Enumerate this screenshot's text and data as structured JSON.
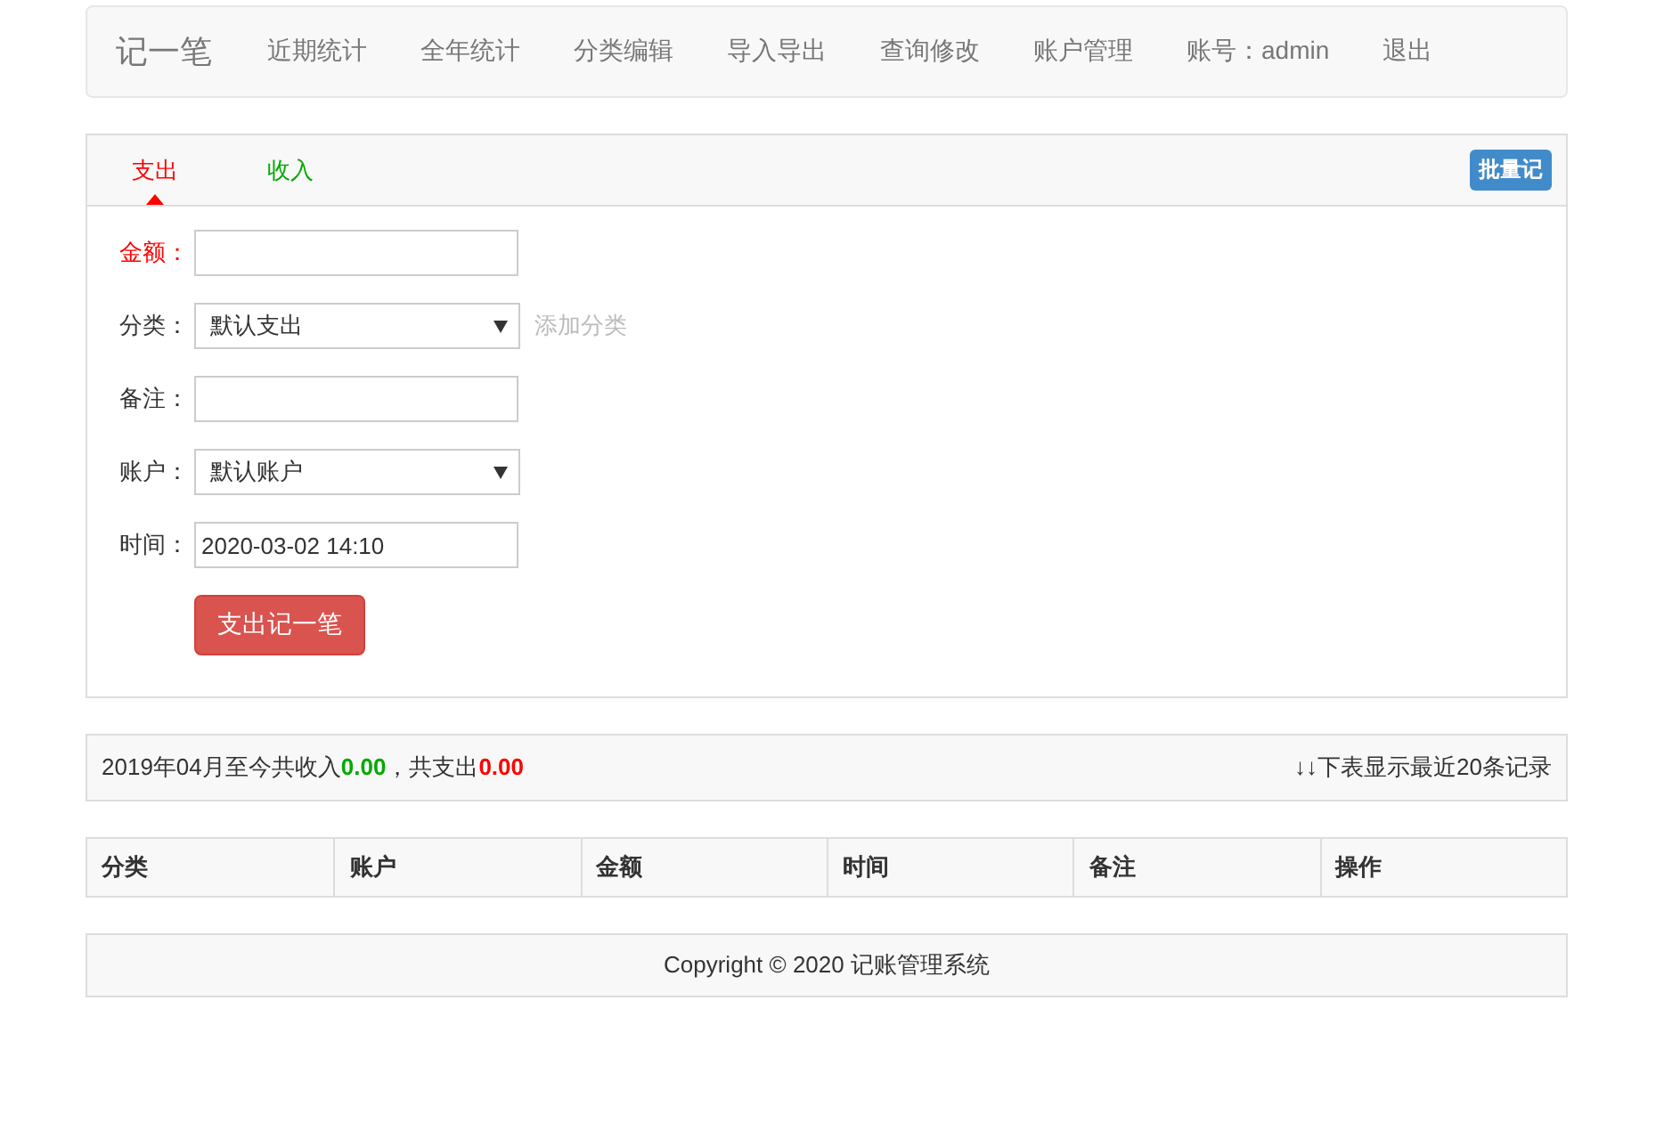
{
  "navbar": {
    "brand": "记一笔",
    "links": [
      "近期统计",
      "全年统计",
      "分类编辑",
      "导入导出",
      "查询修改",
      "账户管理",
      "账号：admin",
      "退出"
    ]
  },
  "tabs": [
    {
      "label": "支出",
      "selected": true,
      "color": "#ff0000"
    },
    {
      "label": "收入",
      "selected": false,
      "color": "#00aa00"
    }
  ],
  "batch_button": "批量记",
  "form": {
    "fields": [
      {
        "kind": "input",
        "label": "金额：",
        "required": true
      },
      {
        "kind": "select",
        "label": "分类：",
        "required": false,
        "value": "默认支出",
        "link": "添加分类"
      },
      {
        "kind": "input",
        "label": "备注：",
        "required": false
      },
      {
        "kind": "select",
        "label": "账户：",
        "required": false,
        "value": "默认账户"
      },
      {
        "kind": "input",
        "label": "时间：",
        "required": false,
        "value": "2020-03-02 14:10"
      }
    ],
    "submit": "支出记一笔"
  },
  "summary": {
    "before": "2019年04月至今共收入",
    "income": "0.00",
    "between": "，共支出",
    "expense": "0.00",
    "note": "↓↓下表显示最近20条记录"
  },
  "table": {
    "columns": [
      "分类",
      "账户",
      "金额",
      "时间",
      "备注",
      "操作"
    ]
  },
  "footer": "Copyright © 2020 记账管理系统"
}
